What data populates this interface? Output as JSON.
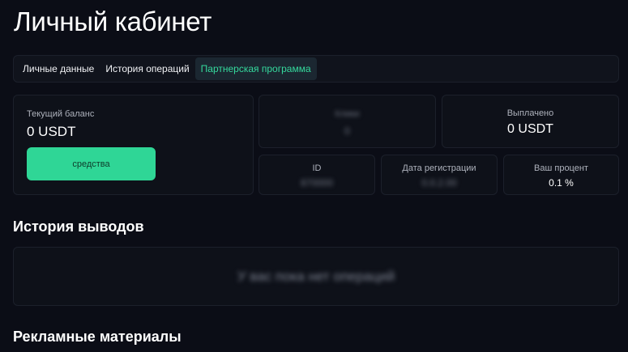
{
  "page": {
    "title": "Личный кабинет"
  },
  "tabs": [
    {
      "label": "Личные данные",
      "active": false
    },
    {
      "label": "История операций",
      "active": false
    },
    {
      "label": "Партнерская программа",
      "active": true
    }
  ],
  "balance": {
    "label": "Текущий баланс",
    "value": "0 USDT",
    "button_label": "средства"
  },
  "stats": {
    "clicks": {
      "label": "Клики",
      "value": "0"
    },
    "paid": {
      "label": "Выплачено",
      "value": "0 USDT"
    },
    "id": {
      "label": "ID",
      "value": "870000"
    },
    "reg_date": {
      "label": "Дата регистрации",
      "value": "0.0.2.00"
    },
    "percent": {
      "label": "Ваш процент",
      "value": "0.1 %"
    }
  },
  "withdrawals": {
    "title": "История выводов",
    "empty_text": "У вас пока нет операций"
  },
  "promo": {
    "title": "Рекламные материалы"
  },
  "colors": {
    "background": "#0b0d16",
    "card": "#0e1119",
    "accent": "#2fd696",
    "active_tab_text": "#35d99d"
  }
}
